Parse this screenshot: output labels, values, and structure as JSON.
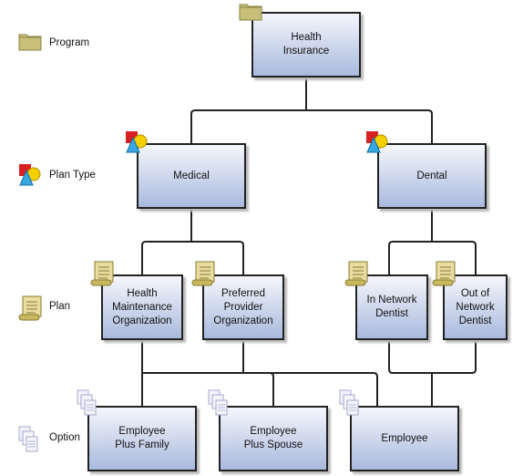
{
  "legend": [
    {
      "icon": "folder-icon",
      "label": "Program"
    },
    {
      "icon": "shapes-icon",
      "label": "Plan Type"
    },
    {
      "icon": "scroll-icon",
      "label": "Plan"
    },
    {
      "icon": "documents-icon",
      "label": "Option"
    }
  ],
  "nodes": {
    "program": {
      "label": "Health\nInsurance",
      "icon": "folder-icon"
    },
    "medical": {
      "label": "Medical",
      "icon": "shapes-icon"
    },
    "dental": {
      "label": "Dental",
      "icon": "shapes-icon"
    },
    "hmo": {
      "label": "Health\nMaintenance\nOrganization",
      "icon": "scroll-icon"
    },
    "ppo": {
      "label": "Preferred\nProvider\nOrganization",
      "icon": "scroll-icon"
    },
    "in_network": {
      "label": "In Network\nDentist",
      "icon": "scroll-icon"
    },
    "out_network": {
      "label": "Out of\nNetwork\nDentist",
      "icon": "scroll-icon"
    },
    "emp_family": {
      "label": "Employee\nPlus Family",
      "icon": "documents-icon"
    },
    "emp_spouse": {
      "label": "Employee\nPlus Spouse",
      "icon": "documents-icon"
    },
    "employee": {
      "label": "Employee",
      "icon": "documents-icon"
    }
  },
  "colors": {
    "box_top": "#f4f6fb",
    "box_bottom": "#a9bade",
    "folder": "#c8c07a",
    "scroll": "#e8dca0"
  }
}
